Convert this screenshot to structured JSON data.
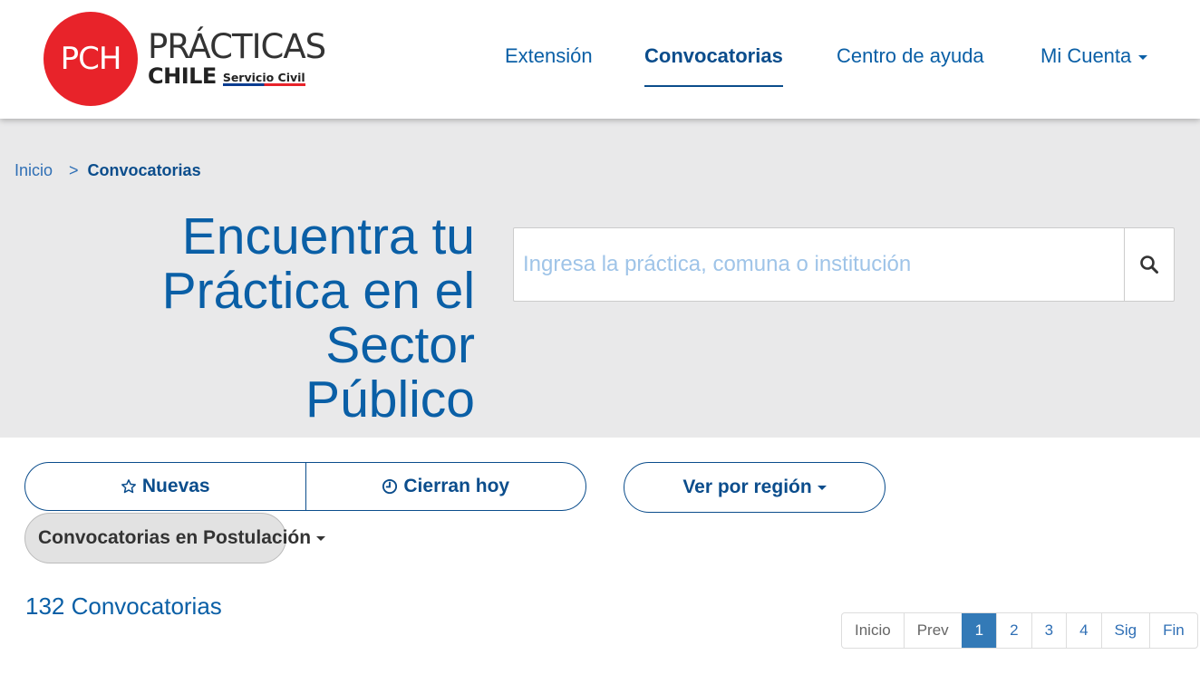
{
  "header": {
    "logo": {
      "badge": "PCH",
      "main": "PRÁCTICAS",
      "sub": "CHILE",
      "tagline": "Servicio Civil"
    },
    "nav": [
      {
        "label": "Extensión"
      },
      {
        "label": "Convocatorias",
        "active": true
      },
      {
        "label": "Centro de ayuda"
      },
      {
        "label": "Mi Cuenta",
        "dropdown": true
      }
    ]
  },
  "breadcrumb": {
    "home": "Inicio",
    "separator": ">",
    "current": "Convocatorias"
  },
  "hero": {
    "title_line1": "Encuentra tu",
    "title_line2": "Práctica en el Sector",
    "title_line3": "Público"
  },
  "search": {
    "placeholder": "Ingresa la práctica, comuna o institución",
    "icon": "search-icon"
  },
  "filters": {
    "nuevas": "Nuevas",
    "cierran_hoy": "Cierran hoy",
    "region": "Ver por región",
    "status": "Convocatorias en Postulación"
  },
  "results": {
    "count_text": "132 Convocatorias"
  },
  "pagination": {
    "first": "Inicio",
    "prev": "Prev",
    "pages": [
      "1",
      "2",
      "3",
      "4"
    ],
    "current": "1",
    "next": "Sig",
    "last": "Fin"
  },
  "colors": {
    "brand_red": "#e8232a",
    "primary_blue": "#0a5fa6",
    "dark_blue": "#0b4d8c",
    "hero_bg": "#e9e9ea",
    "active_page": "#337ab7"
  }
}
